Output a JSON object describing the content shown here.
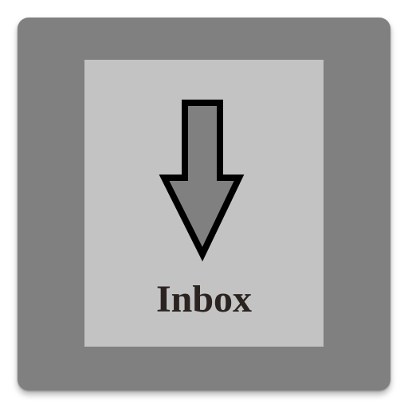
{
  "app_icon": {
    "name": "inbox-shortcut",
    "label": "Inbox",
    "icon": "arrow-down-icon",
    "colors": {
      "frame": "#808080",
      "tile": "#c3c3c3",
      "arrow_fill": "#808080",
      "arrow_stroke": "#000000",
      "label_text": "#2b2320"
    }
  }
}
